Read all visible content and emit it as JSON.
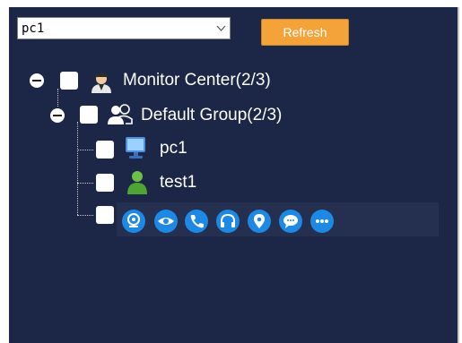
{
  "toolbar": {
    "selected_device": "pc1",
    "refresh_label": "Refresh"
  },
  "tree": {
    "root": {
      "label": "Monitor Center(2/3)",
      "icon": "monitor-center-user-icon"
    },
    "group": {
      "label": "Default Group(2/3)",
      "icon": "group-users-icon"
    },
    "devices": [
      {
        "label": "pc1",
        "icon": "computer-icon"
      },
      {
        "label": "test1",
        "icon": "user-green-icon"
      }
    ],
    "actions": [
      {
        "name": "webcam",
        "icon": "webcam-icon"
      },
      {
        "name": "view",
        "icon": "eye-icon"
      },
      {
        "name": "call",
        "icon": "phone-icon"
      },
      {
        "name": "listen",
        "icon": "headphones-icon"
      },
      {
        "name": "location",
        "icon": "location-pin-icon"
      },
      {
        "name": "message",
        "icon": "chat-bubble-icon"
      },
      {
        "name": "more",
        "icon": "more-dots-icon"
      }
    ]
  },
  "colors": {
    "panel_bg": "#1c2647",
    "refresh_bg": "#f4a338",
    "action_blue": "#1e88e5",
    "text": "#ffffff"
  }
}
